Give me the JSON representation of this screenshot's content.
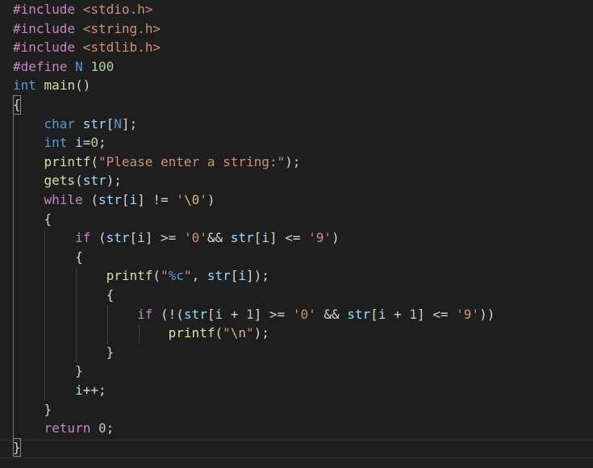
{
  "editor": {
    "language": "c",
    "colors": {
      "background": "#1e1e1e",
      "text": "#d4d4d4",
      "directive": "#c586c0",
      "include_path": "#ce9178",
      "keyword": "#569cd6",
      "control": "#c586c0",
      "function": "#dcdcaa",
      "variable": "#9cdcfe",
      "string": "#ce9178",
      "number": "#b5cea8",
      "escape": "#d7ba7d"
    },
    "lines": [
      {
        "tokens": [
          {
            "t": "#include ",
            "c": "t-dir"
          },
          {
            "t": "<stdio.h>",
            "c": "t-inc"
          }
        ]
      },
      {
        "tokens": [
          {
            "t": "#include ",
            "c": "t-dir"
          },
          {
            "t": "<string.h>",
            "c": "t-inc"
          }
        ]
      },
      {
        "tokens": [
          {
            "t": "#include ",
            "c": "t-dir"
          },
          {
            "t": "<stdlib.h>",
            "c": "t-inc"
          }
        ]
      },
      {
        "tokens": [
          {
            "t": "#define ",
            "c": "t-dir"
          },
          {
            "t": "N",
            "c": "t-mac"
          },
          {
            "t": " "
          },
          {
            "t": "100",
            "c": "t-num"
          }
        ]
      },
      {
        "tokens": [
          {
            "t": "int",
            "c": "t-kw"
          },
          {
            "t": " "
          },
          {
            "t": "main",
            "c": "t-fn"
          },
          {
            "t": "()"
          }
        ]
      },
      {
        "tokens": [
          {
            "t": "{",
            "c": "bracket"
          }
        ]
      },
      {
        "tokens": [
          {
            "t": "    "
          },
          {
            "t": "char",
            "c": "t-kw"
          },
          {
            "t": " "
          },
          {
            "t": "str",
            "c": "t-var"
          },
          {
            "t": "["
          },
          {
            "t": "N",
            "c": "t-mac"
          },
          {
            "t": "];"
          }
        ]
      },
      {
        "tokens": [
          {
            "t": "    "
          },
          {
            "t": "int",
            "c": "t-kw"
          },
          {
            "t": " "
          },
          {
            "t": "i",
            "c": "t-var"
          },
          {
            "t": "="
          },
          {
            "t": "0",
            "c": "t-num"
          },
          {
            "t": ";"
          }
        ]
      },
      {
        "tokens": [
          {
            "t": "    "
          },
          {
            "t": "printf",
            "c": "t-fn"
          },
          {
            "t": "("
          },
          {
            "t": "\"Please enter a string:\"",
            "c": "t-str"
          },
          {
            "t": ");"
          }
        ]
      },
      {
        "tokens": [
          {
            "t": "    "
          },
          {
            "t": "gets",
            "c": "t-fn"
          },
          {
            "t": "("
          },
          {
            "t": "str",
            "c": "t-var"
          },
          {
            "t": ");"
          }
        ]
      },
      {
        "tokens": [
          {
            "t": "    "
          },
          {
            "t": "while",
            "c": "t-ctl"
          },
          {
            "t": " ("
          },
          {
            "t": "str",
            "c": "t-var"
          },
          {
            "t": "["
          },
          {
            "t": "i",
            "c": "t-var"
          },
          {
            "t": "] != "
          },
          {
            "t": "'",
            "c": "t-str"
          },
          {
            "t": "\\0",
            "c": "t-esc"
          },
          {
            "t": "'",
            "c": "t-str"
          },
          {
            "t": ")"
          }
        ]
      },
      {
        "tokens": [
          {
            "t": "    "
          },
          {
            "t": "{"
          }
        ]
      },
      {
        "tokens": [
          {
            "t": "        "
          },
          {
            "t": "if",
            "c": "t-ctl"
          },
          {
            "t": " ("
          },
          {
            "t": "str",
            "c": "t-var"
          },
          {
            "t": "["
          },
          {
            "t": "i",
            "c": "t-var"
          },
          {
            "t": "] >= "
          },
          {
            "t": "'0'",
            "c": "t-str"
          },
          {
            "t": "&& "
          },
          {
            "t": "str",
            "c": "t-var"
          },
          {
            "t": "["
          },
          {
            "t": "i",
            "c": "t-var"
          },
          {
            "t": "] <= "
          },
          {
            "t": "'9'",
            "c": "t-str"
          },
          {
            "t": ")"
          }
        ]
      },
      {
        "tokens": [
          {
            "t": "        "
          },
          {
            "t": "{"
          }
        ]
      },
      {
        "tokens": [
          {
            "t": "            "
          },
          {
            "t": "printf",
            "c": "t-fn"
          },
          {
            "t": "("
          },
          {
            "t": "\"",
            "c": "t-str"
          },
          {
            "t": "%c",
            "c": "t-mac"
          },
          {
            "t": "\"",
            "c": "t-str"
          },
          {
            "t": ", "
          },
          {
            "t": "str",
            "c": "t-var"
          },
          {
            "t": "["
          },
          {
            "t": "i",
            "c": "t-var"
          },
          {
            "t": "]);"
          }
        ]
      },
      {
        "tokens": [
          {
            "t": "            "
          },
          {
            "t": "{"
          }
        ]
      },
      {
        "tokens": [
          {
            "t": "                "
          },
          {
            "t": "if",
            "c": "t-ctl"
          },
          {
            "t": " (!("
          },
          {
            "t": "str",
            "c": "t-var"
          },
          {
            "t": "["
          },
          {
            "t": "i",
            "c": "t-var"
          },
          {
            "t": " + "
          },
          {
            "t": "1",
            "c": "t-num"
          },
          {
            "t": "] >= "
          },
          {
            "t": "'0'",
            "c": "t-str"
          },
          {
            "t": " && "
          },
          {
            "t": "str",
            "c": "t-var"
          },
          {
            "t": "["
          },
          {
            "t": "i",
            "c": "t-var"
          },
          {
            "t": " + "
          },
          {
            "t": "1",
            "c": "t-num"
          },
          {
            "t": "] <= "
          },
          {
            "t": "'9'",
            "c": "t-str"
          },
          {
            "t": "))"
          }
        ]
      },
      {
        "tokens": [
          {
            "t": "                    "
          },
          {
            "t": "printf",
            "c": "t-fn"
          },
          {
            "t": "("
          },
          {
            "t": "\"",
            "c": "t-str"
          },
          {
            "t": "\\n",
            "c": "t-esc"
          },
          {
            "t": "\"",
            "c": "t-str"
          },
          {
            "t": ");"
          }
        ]
      },
      {
        "tokens": [
          {
            "t": "            "
          },
          {
            "t": "}"
          }
        ]
      },
      {
        "tokens": [
          {
            "t": "        "
          },
          {
            "t": "}"
          }
        ]
      },
      {
        "tokens": [
          {
            "t": "        "
          },
          {
            "t": "i",
            "c": "t-var"
          },
          {
            "t": "++;"
          }
        ]
      },
      {
        "tokens": [
          {
            "t": "    "
          },
          {
            "t": "}"
          }
        ]
      },
      {
        "tokens": [
          {
            "t": "    "
          },
          {
            "t": "return",
            "c": "t-ctl"
          },
          {
            "t": " "
          },
          {
            "t": "0",
            "c": "t-num"
          },
          {
            "t": ";"
          }
        ]
      },
      {
        "tokens": [
          {
            "t": "}",
            "c": "bracket"
          }
        ]
      }
    ]
  }
}
